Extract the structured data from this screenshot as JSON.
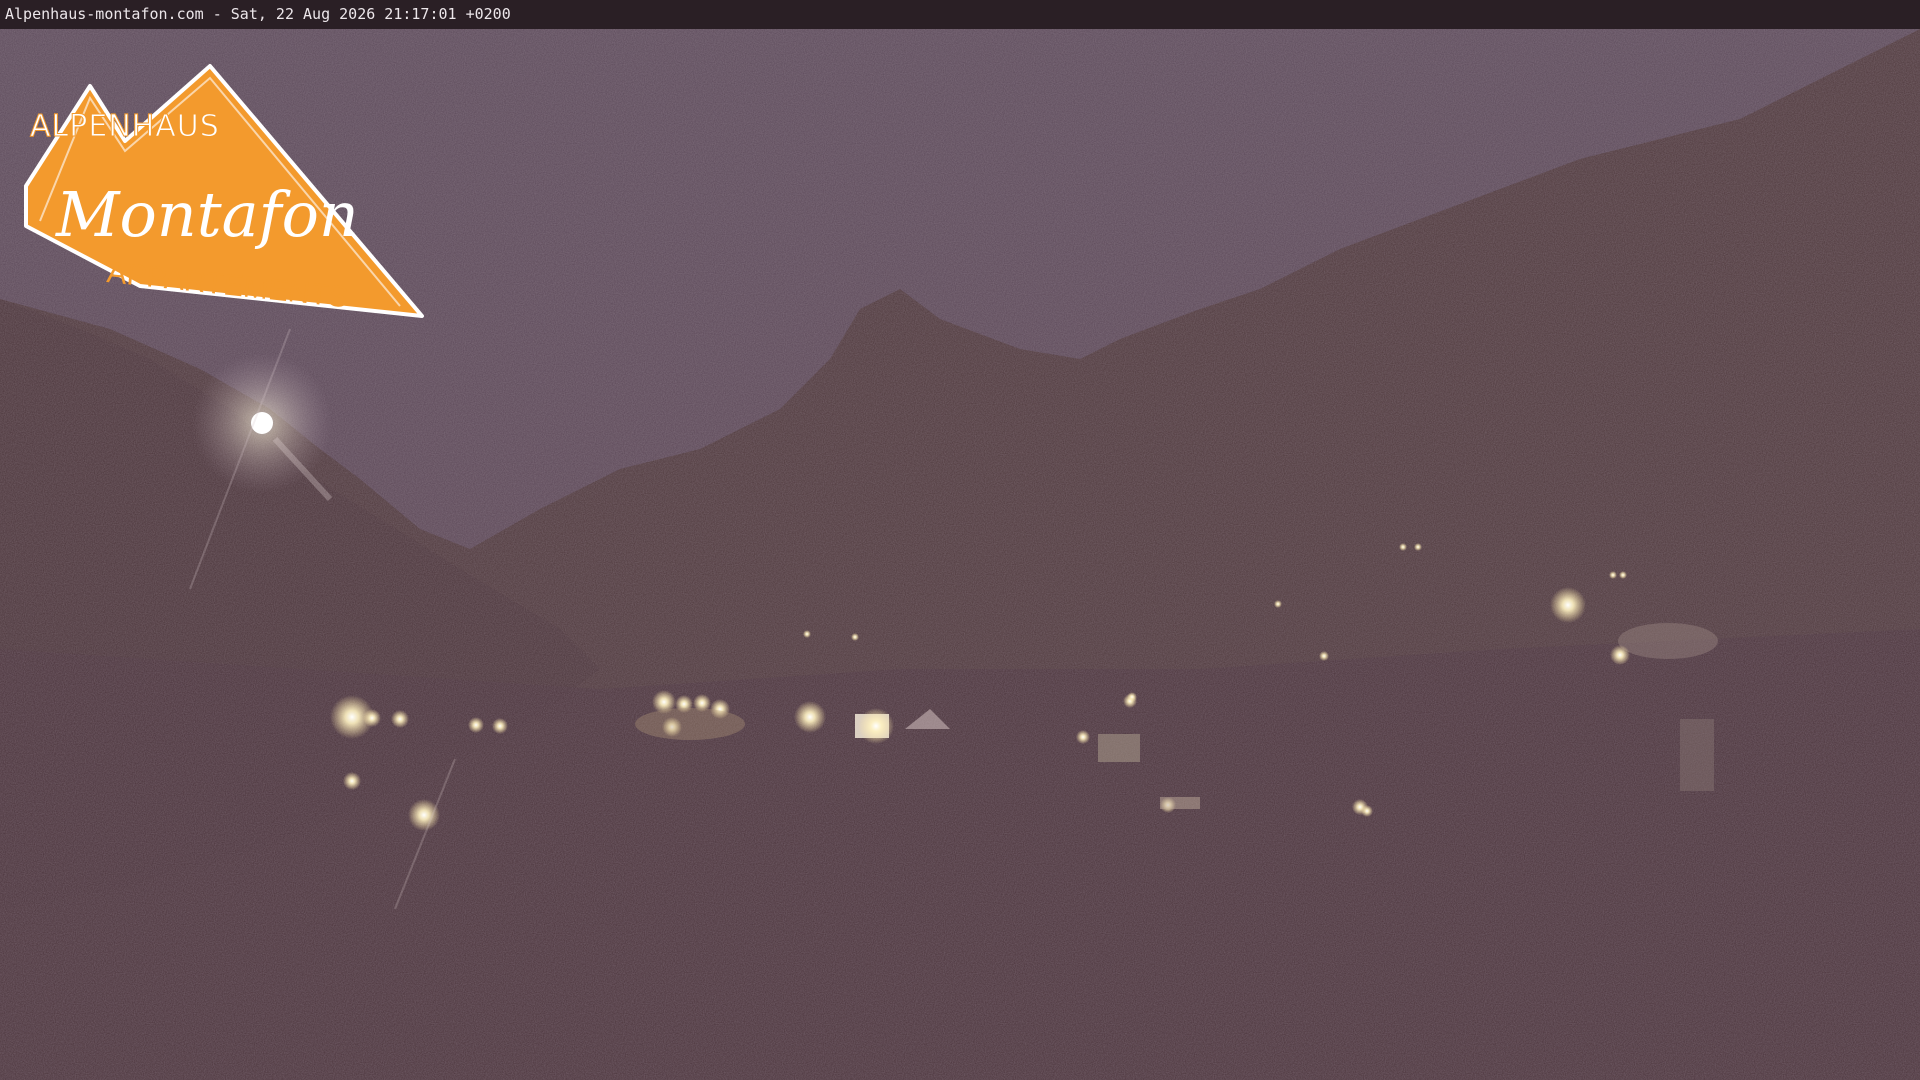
{
  "overlay": {
    "caption": "Alpenhaus-montafon.com - Sat, 22 Aug 2026 21:17:01 +0200"
  },
  "logo": {
    "line1": "ALPENHAUS",
    "line2": "Montafon",
    "line3": "APPARTEMENTS",
    "color": "#f39a2d"
  },
  "scene": {
    "sky_color": "#584350",
    "mountain_color": "#4e383c",
    "foreground_color": "#48323a",
    "light_color": "#fff3c4"
  }
}
